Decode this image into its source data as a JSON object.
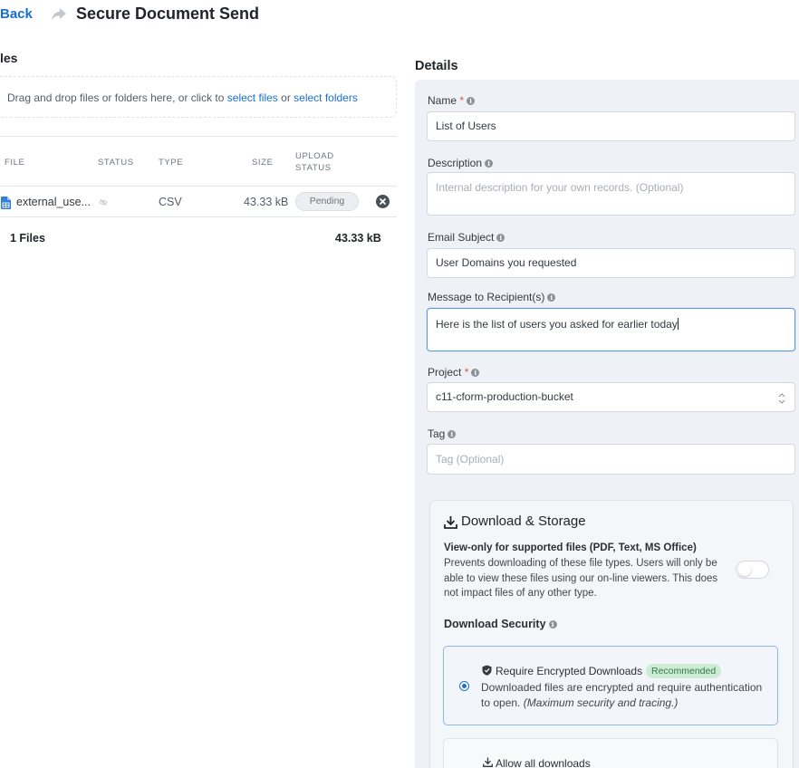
{
  "header": {
    "back_label": "Back",
    "title": "Secure Document Send"
  },
  "files": {
    "heading": "les",
    "dropzone": {
      "text_before": "Drag and drop files or folders here, or click to ",
      "select_files_link": "select files",
      "text_middle": " or ",
      "select_folders_link": "select folders"
    },
    "columns": {
      "file": "FILE",
      "status": "STATUS",
      "type": "TYPE",
      "size": "SIZE",
      "upload_status": "UPLOAD STATUS"
    },
    "rows": [
      {
        "name": "external_use...",
        "type": "CSV",
        "size": "43.33 kB",
        "upload_status": "Pending"
      }
    ],
    "total_files": "1 Files",
    "total_size": "43.33 kB"
  },
  "details": {
    "heading": "Details",
    "name": {
      "label": "Name",
      "required_mark": "*",
      "value": "List of Users"
    },
    "description": {
      "label": "Description",
      "placeholder": "Internal description for your own records. (Optional)"
    },
    "email_subject": {
      "label": "Email Subject",
      "value": "User Domains you requested"
    },
    "message": {
      "label": "Message to Recipient(s)",
      "value": "Here is the list of users you asked for earlier today"
    },
    "project": {
      "label": "Project",
      "required_mark": "*",
      "selected": "c11-cform-production-bucket"
    },
    "tag": {
      "label": "Tag",
      "placeholder": "Tag (Optional)"
    },
    "info_glyph": "i"
  },
  "download_storage": {
    "title": "Download & Storage",
    "view_only": {
      "title": "View-only for supported files (PDF, Text, MS Office)",
      "description": "Prevents downloading of these file types. Users will only be able to view these files using our on-line viewers. This does not impact files of any other type.",
      "enabled": false
    },
    "security_label": "Download Security",
    "options": [
      {
        "title": "Require Encrypted Downloads",
        "badge": "Recommended",
        "description": "Downloaded files are encrypted and require authentication to open.",
        "note": "(Maximum security and tracing.)",
        "selected": true
      },
      {
        "title": "Allow all downloads",
        "selected": false
      }
    ]
  },
  "colors": {
    "link": "#1a6fd1",
    "panel_bg": "#eef2f6",
    "badge_green_bg": "#cdebd5",
    "required": "#d9534f"
  }
}
